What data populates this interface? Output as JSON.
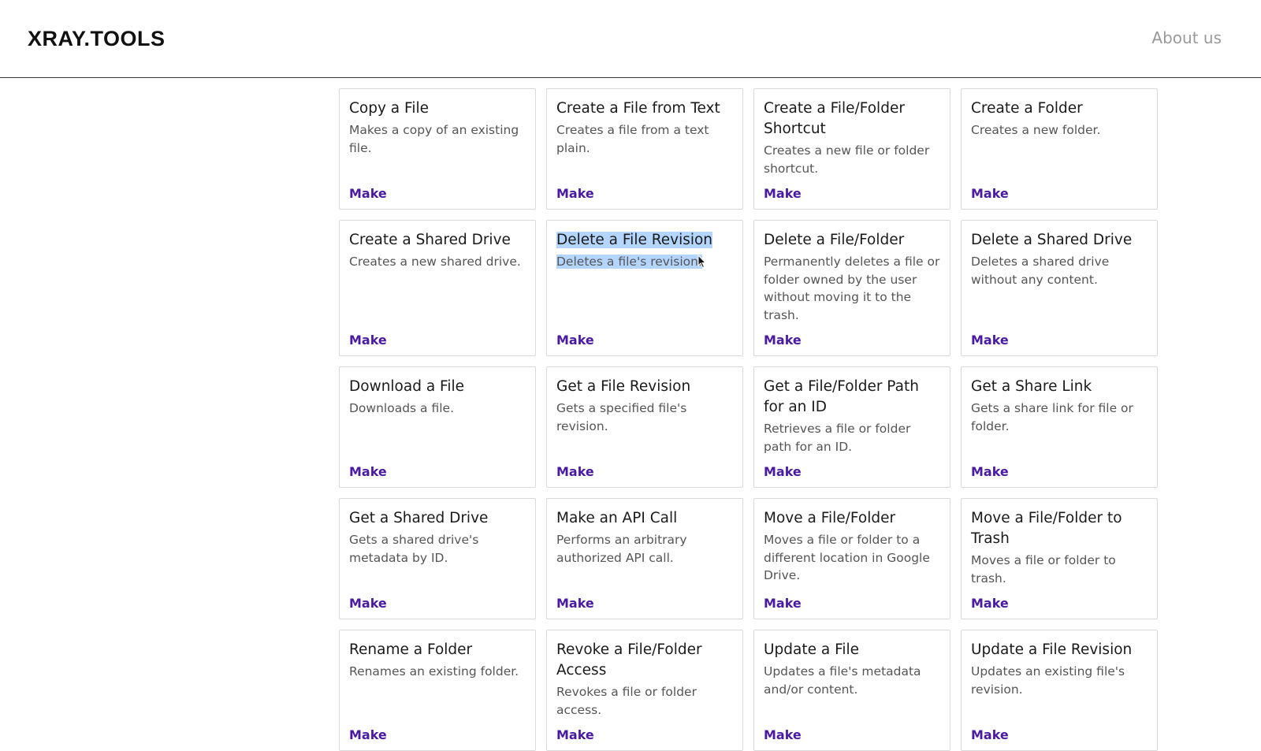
{
  "header": {
    "logo": "XRAY.TOOLS",
    "about_link": "About us"
  },
  "make_label": "Make",
  "cards": [
    {
      "title": "Copy a File",
      "desc": "Makes a copy of an existing file."
    },
    {
      "title": "Create a File from Text",
      "desc": "Creates a file from a text plain."
    },
    {
      "title": "Create a File/Folder Shortcut",
      "desc": "Creates a new file or folder shortcut."
    },
    {
      "title": "Create a Folder",
      "desc": "Creates a new folder."
    },
    {
      "title": "Create a Shared Drive",
      "desc": "Creates a new shared drive."
    },
    {
      "title": "Delete a File Revision",
      "desc": "Deletes a file's revision.",
      "selected": true
    },
    {
      "title": "Delete a File/Folder",
      "desc": "Permanently deletes a file or folder owned by the user without moving it to the trash."
    },
    {
      "title": "Delete a Shared Drive",
      "desc": "Deletes a shared drive without any content."
    },
    {
      "title": "Download a File",
      "desc": "Downloads a file."
    },
    {
      "title": "Get a File Revision",
      "desc": "Gets a specified file's revision."
    },
    {
      "title": "Get a File/Folder Path for an ID",
      "desc": "Retrieves a file or folder path for an ID."
    },
    {
      "title": "Get a Share Link",
      "desc": "Gets a share link for file or folder."
    },
    {
      "title": "Get a Shared Drive",
      "desc": "Gets a shared drive's metadata by ID."
    },
    {
      "title": "Make an API Call",
      "desc": "Performs an arbitrary authorized API call."
    },
    {
      "title": "Move a File/Folder",
      "desc": "Moves a file or folder to a different location in Google Drive."
    },
    {
      "title": "Move a File/Folder to Trash",
      "desc": "Moves a file or folder to trash."
    },
    {
      "title": "Rename a Folder",
      "desc": "Renames an existing folder."
    },
    {
      "title": "Revoke a File/Folder Access",
      "desc": "Revokes a file or folder access."
    },
    {
      "title": "Update a File",
      "desc": "Updates a file's metadata and/or content."
    },
    {
      "title": "Update a File Revision",
      "desc": "Updates an existing file's revision."
    }
  ]
}
